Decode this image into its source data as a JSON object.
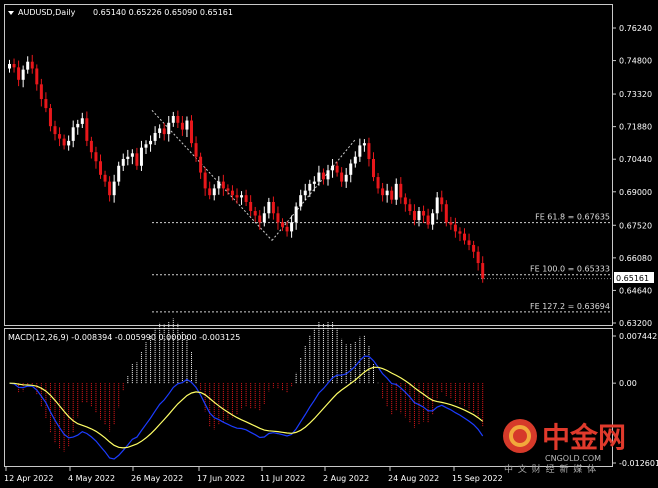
{
  "header": {
    "symbol": "AUDUSD,Daily",
    "ohlc": "0.65140 0.65226 0.65090 0.65161"
  },
  "macd_header": "MACD(12,26,9) -0.008394 -0.005990 0.000000 -0.003125",
  "price_axis": [
    "0.76240",
    "0.74800",
    "0.73320",
    "0.71880",
    "0.70440",
    "0.69000",
    "0.67520",
    "0.66080",
    "0.64640",
    "0.63200"
  ],
  "current_price": "0.65161",
  "macd_axis": [
    "0.007442",
    "0.00",
    "-0.012601"
  ],
  "date_axis": [
    "12 Apr 2022",
    "4 May 2022",
    "26 May 2022",
    "17 Jun 2022",
    "11 Jul 2022",
    "2 Aug 2022",
    "24 Aug 2022",
    "15 Sep 2022"
  ],
  "fibonacci": [
    {
      "label": "FE 61.8 = 0.67635",
      "price": 0.67635
    },
    {
      "label": "FE 100.0 = 0.65333",
      "price": 0.65333
    },
    {
      "label": "FE 127.2 = 0.63694",
      "price": 0.63694
    }
  ],
  "watermark": {
    "brand": "中金网",
    "sub": "CNGOLD.COM",
    "slogan": "中 文 财 经 新 媒 体"
  },
  "colors": {
    "bull": "#ffffff",
    "bear": "#e8171b",
    "macd_line": "#1c3cff",
    "signal_line": "#ffff66",
    "fib": "#cfcfcf",
    "watermark": "#d63a2a"
  },
  "chart_data": {
    "type": "candlestick",
    "symbol": "AUDUSD",
    "timeframe": "Daily",
    "closes": [
      0.7465,
      0.745,
      0.7395,
      0.744,
      0.7475,
      0.7445,
      0.7375,
      0.731,
      0.727,
      0.719,
      0.7155,
      0.7135,
      0.7105,
      0.7125,
      0.7185,
      0.72,
      0.7225,
      0.7125,
      0.7075,
      0.7035,
      0.6975,
      0.6945,
      0.6885,
      0.6945,
      0.7015,
      0.7045,
      0.7055,
      0.707,
      0.7015,
      0.7095,
      0.711,
      0.7125,
      0.716,
      0.718,
      0.7155,
      0.7205,
      0.7235,
      0.7205,
      0.7175,
      0.7215,
      0.7115,
      0.7055,
      0.6985,
      0.6915,
      0.6885,
      0.6915,
      0.6945,
      0.6915,
      0.6905,
      0.6885,
      0.6875,
      0.6885,
      0.6855,
      0.6815,
      0.6795,
      0.6765,
      0.6805,
      0.6855,
      0.6805,
      0.6765,
      0.6745,
      0.6725,
      0.6765,
      0.6835,
      0.6885,
      0.6905,
      0.6935,
      0.6945,
      0.6985,
      0.6955,
      0.6995,
      0.7015,
      0.6985,
      0.6945,
      0.6975,
      0.7025,
      0.7055,
      0.7105,
      0.7115,
      0.7045,
      0.6965,
      0.6915,
      0.6885,
      0.6905,
      0.6865,
      0.6935,
      0.6875,
      0.6845,
      0.6815,
      0.6775,
      0.6815,
      0.6795,
      0.6755,
      0.6805,
      0.6875,
      0.6845,
      0.6765,
      0.6755,
      0.6725,
      0.6715,
      0.6685,
      0.6665,
      0.6635,
      0.6585,
      0.6516
    ]
  }
}
